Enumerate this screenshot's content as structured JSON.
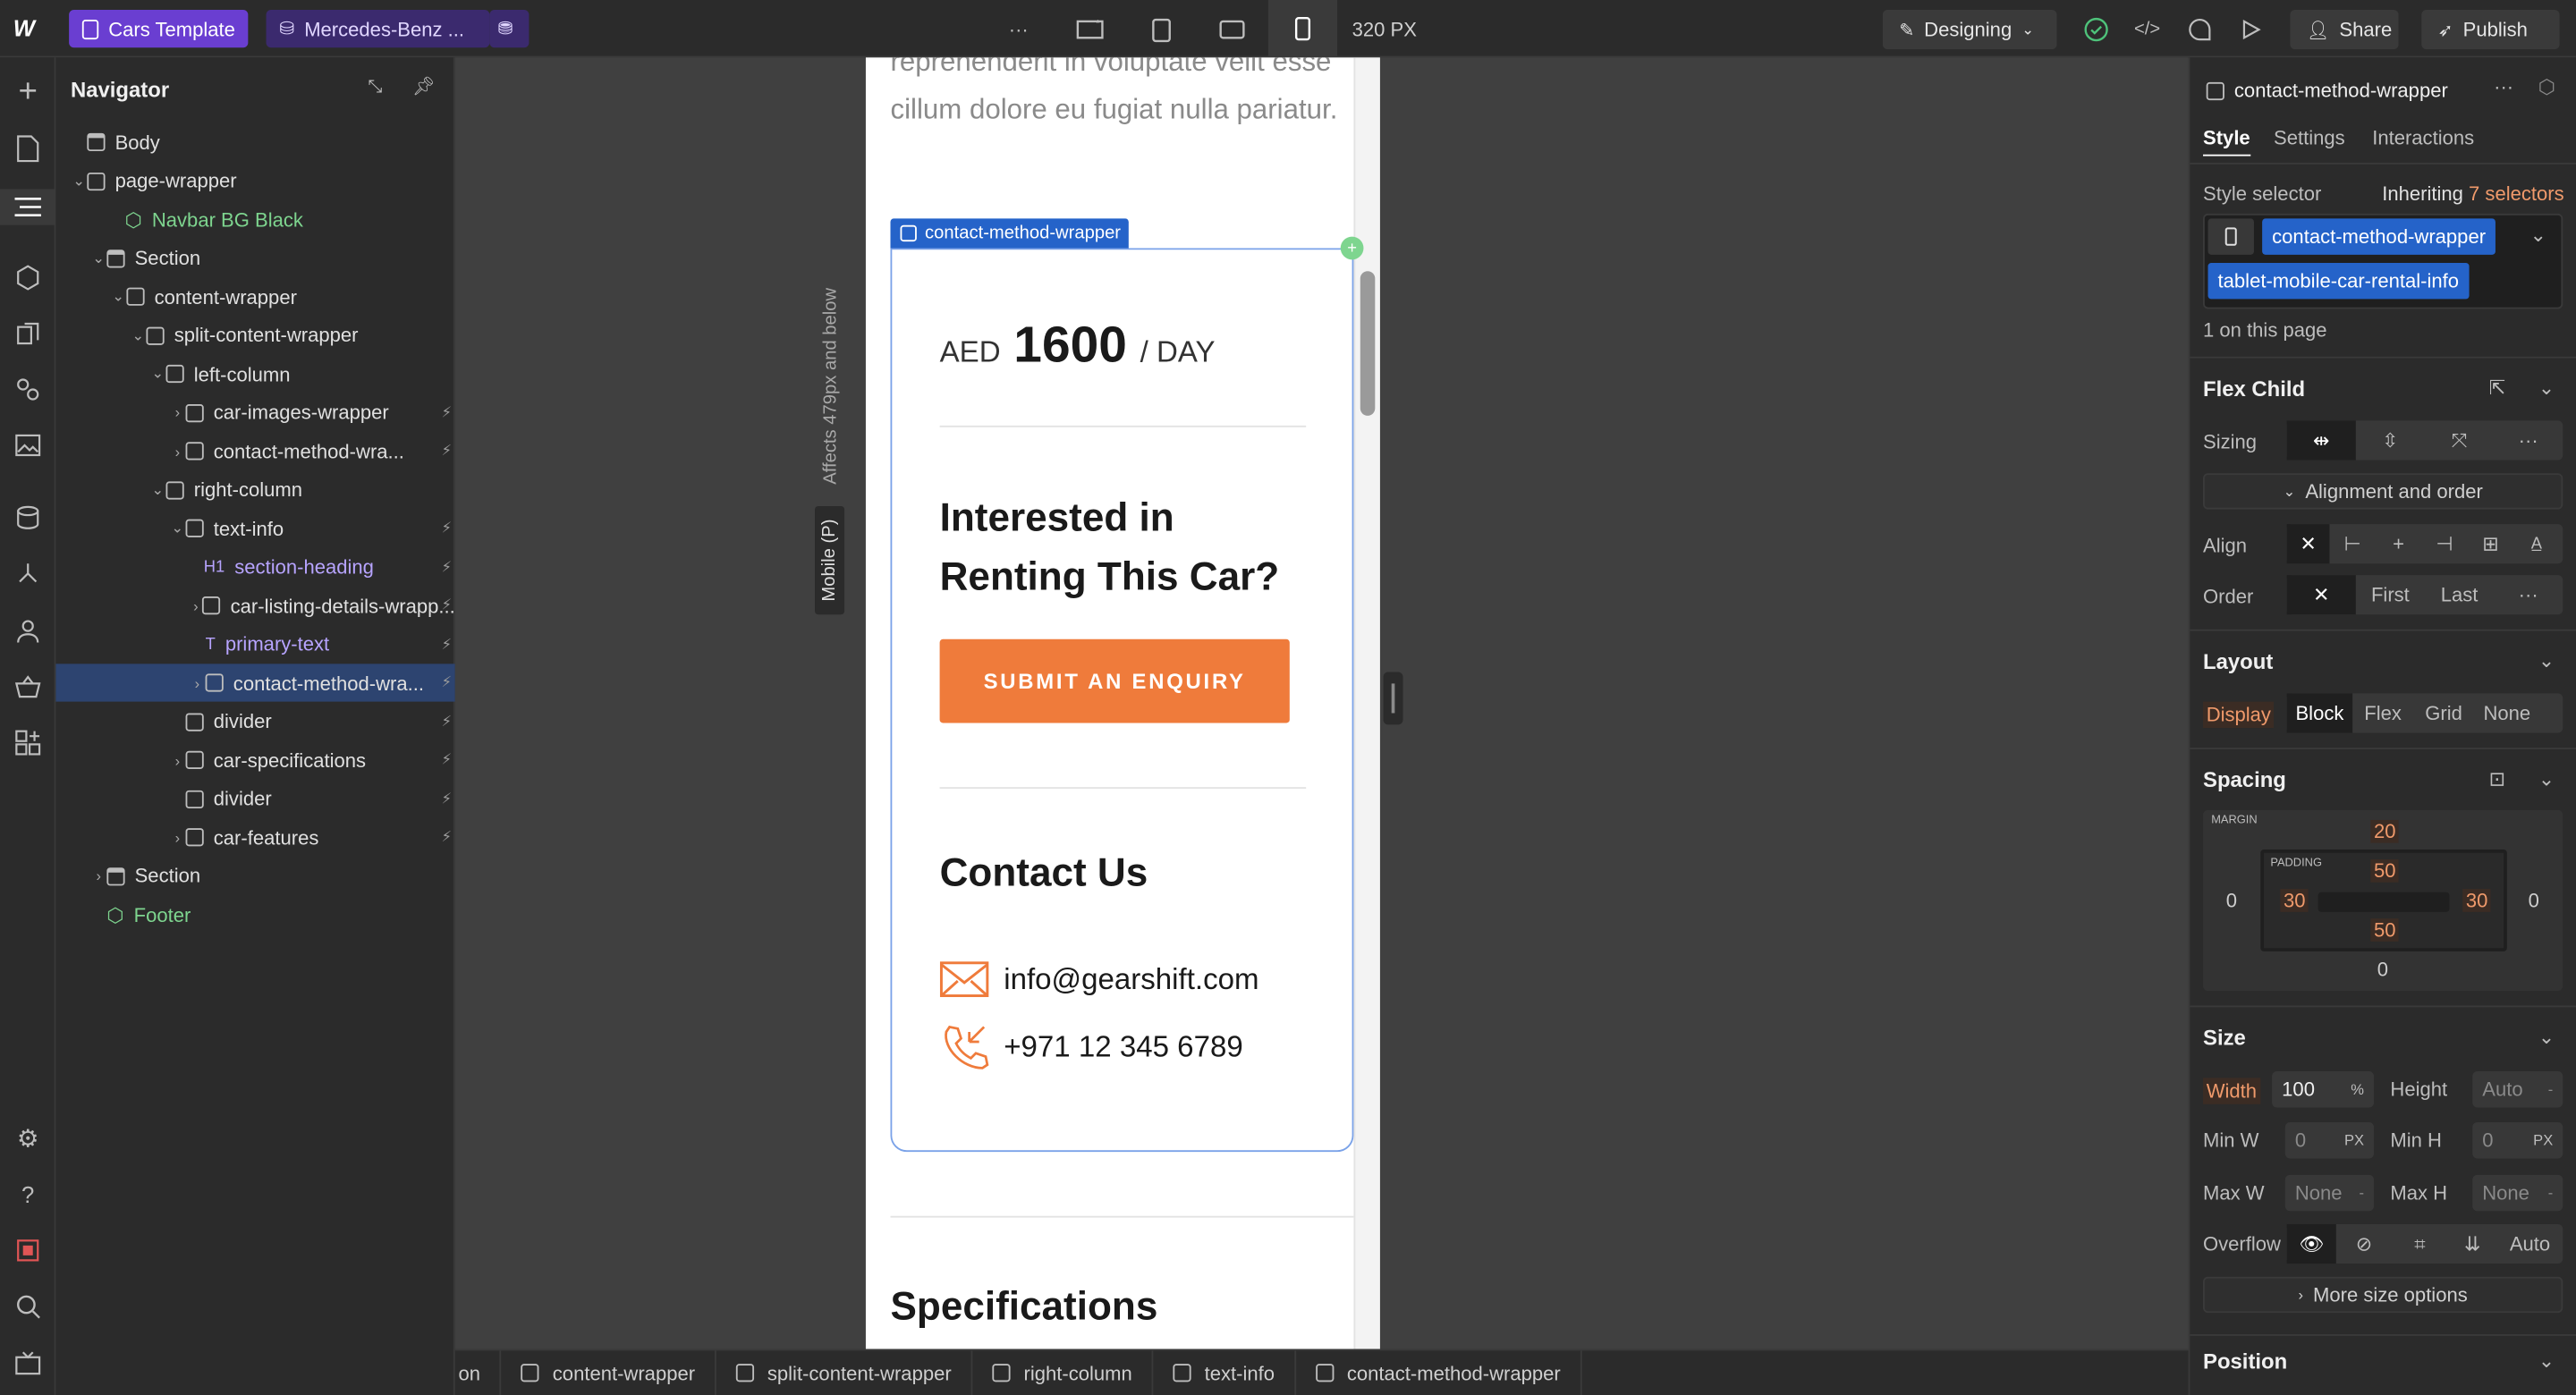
{
  "topbar": {
    "project_name": "Cars Template",
    "page_name": "Mercedes-Benz ...",
    "breakpoint_width": "320 PX",
    "mode": "Designing",
    "share": "Share",
    "publish": "Publish"
  },
  "navigator": {
    "title": "Navigator",
    "items": [
      {
        "label": "Body",
        "type": "page"
      },
      {
        "label": "page-wrapper",
        "type": "div"
      },
      {
        "label": "Navbar BG Black",
        "type": "component"
      },
      {
        "label": "Section",
        "type": "section"
      },
      {
        "label": "content-wrapper",
        "type": "div"
      },
      {
        "label": "split-content-wrapper",
        "type": "div"
      },
      {
        "label": "left-column",
        "type": "div"
      },
      {
        "label": "car-images-wrapper",
        "type": "div"
      },
      {
        "label": "contact-method-wra...",
        "type": "div"
      },
      {
        "label": "right-column",
        "type": "div"
      },
      {
        "label": "text-info",
        "type": "div"
      },
      {
        "label": "section-heading",
        "type": "heading",
        "prefix": "H1"
      },
      {
        "label": "car-listing-details-wrapp...",
        "type": "div"
      },
      {
        "label": "primary-text",
        "type": "text",
        "prefix": "T"
      },
      {
        "label": "contact-method-wra...",
        "type": "div",
        "selected": true
      },
      {
        "label": "divider",
        "type": "div"
      },
      {
        "label": "car-specifications",
        "type": "div"
      },
      {
        "label": "divider",
        "type": "div"
      },
      {
        "label": "car-features",
        "type": "div"
      },
      {
        "label": "Section",
        "type": "section"
      },
      {
        "label": "Footer",
        "type": "component"
      }
    ]
  },
  "canvas": {
    "breakpoint_label": "Mobile (P)",
    "affects_label": "Affects 479px and below",
    "selected_label": "contact-method-wrapper",
    "page": {
      "intro_text": "reprehenderit in voluptate velit esse cillum dolore eu fugiat nulla pariatur.",
      "price_currency": "AED",
      "price_value": "1600",
      "price_unit": "/ DAY",
      "interest_heading": "Interested in Renting This Car?",
      "enquiry_button": "SUBMIT AN ENQUIRY",
      "contact_heading": "Contact Us",
      "email": "info@gearshift.com",
      "phone": "+971 12 345 6789",
      "specs_heading": "Specifications"
    }
  },
  "breadcrumbs": [
    "on",
    "content-wrapper",
    "split-content-wrapper",
    "right-column",
    "text-info",
    "contact-method-wrapper"
  ],
  "panel": {
    "element_name": "contact-method-wrapper",
    "tabs": [
      "Style",
      "Settings",
      "Interactions"
    ],
    "style_selector_label": "Style selector",
    "inheriting": "Inheriting",
    "inheriting_count": "7 selectors",
    "selector_1": "contact-method-wrapper",
    "selector_2": "tablet-mobile-car-rental-info",
    "on_page": "1 on this page",
    "flex_child": {
      "title": "Flex Child",
      "sizing_label": "Sizing",
      "alignment_order": "Alignment and order",
      "align_label": "Align",
      "order_label": "Order",
      "order_first": "First",
      "order_last": "Last"
    },
    "layout": {
      "title": "Layout",
      "display_label": "Display",
      "options": [
        "Block",
        "Flex",
        "Grid",
        "None"
      ],
      "selected": "Block"
    },
    "spacing": {
      "title": "Spacing",
      "margin_label": "MARGIN",
      "padding_label": "PADDING",
      "margin": {
        "top": "20",
        "right": "0",
        "bottom": "0",
        "left": "0"
      },
      "padding": {
        "top": "50",
        "right": "30",
        "bottom": "50",
        "left": "30"
      }
    },
    "size": {
      "title": "Size",
      "width_label": "Width",
      "width_value": "100",
      "width_unit": "%",
      "height_label": "Height",
      "height_value": "Auto",
      "minw_label": "Min W",
      "minw_value": "0",
      "minw_unit": "PX",
      "minh_label": "Min H",
      "minh_value": "0",
      "minh_unit": "PX",
      "maxw_label": "Max W",
      "maxw_value": "None",
      "maxh_label": "Max H",
      "maxh_value": "None",
      "overflow_label": "Overflow",
      "overflow_auto": "Auto",
      "more": "More size options"
    },
    "position": {
      "title": "Position"
    }
  },
  "colors": {
    "accent": "#ef7b3b",
    "selection": "#2563c9",
    "panel": "#2b2b2b"
  }
}
